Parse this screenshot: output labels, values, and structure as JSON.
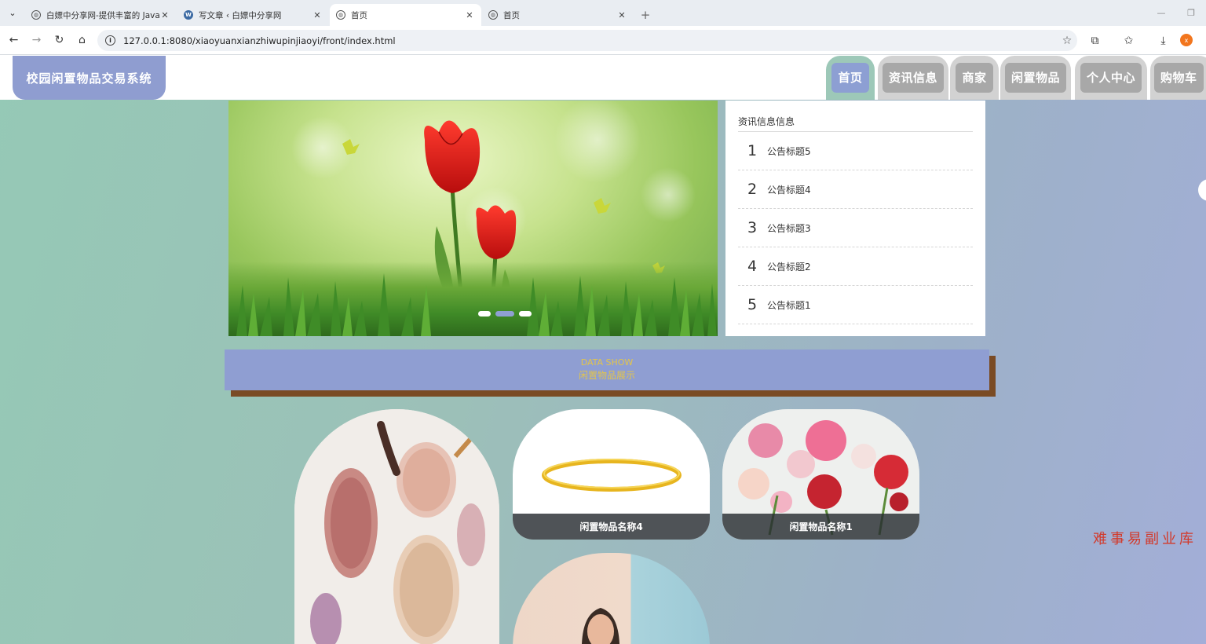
{
  "browser": {
    "tabs": [
      {
        "title": "白嫖中分享网-提供丰富的 Java",
        "active": false,
        "icon": "globe-icon"
      },
      {
        "title": "写文章 ‹ 白嫖中分享网",
        "active": false,
        "icon": "wordpress-icon"
      },
      {
        "title": "首页",
        "active": true,
        "icon": "globe-icon"
      },
      {
        "title": "首页",
        "active": false,
        "icon": "globe-icon"
      }
    ],
    "url": "127.0.0.1:8080/xiaoyuanxianzhiwupinjiaoyi/front/index.html",
    "avatar_letter": "x"
  },
  "site": {
    "title": "校园闲置物品交易系统",
    "nav": [
      "首页",
      "资讯信息",
      "商家",
      "闲置物品",
      "个人中心",
      "购物车"
    ],
    "active_nav": 0
  },
  "carousel": {
    "slides": 3,
    "active_slide": 1
  },
  "news": {
    "heading": "资讯信息信息",
    "items": [
      {
        "num": "1",
        "title": "公告标题5"
      },
      {
        "num": "2",
        "title": "公告标题4"
      },
      {
        "num": "3",
        "title": "公告标题3"
      },
      {
        "num": "4",
        "title": "公告标题2"
      },
      {
        "num": "5",
        "title": "公告标题1"
      }
    ]
  },
  "section": {
    "en": "DATA SHOW",
    "cn": "闲置物品展示"
  },
  "products": [
    {
      "name": "闲置物品名称4",
      "image": "gold-bangle"
    },
    {
      "name": "闲置物品名称1",
      "image": "ranunculus-flowers"
    }
  ],
  "watermark": "难事易副业库",
  "colors": {
    "accent": "#8f9ed2",
    "menu_active_bg": "#9dc8b8",
    "section_text": "#e3c54a",
    "section_shadow": "#7a4b24"
  }
}
